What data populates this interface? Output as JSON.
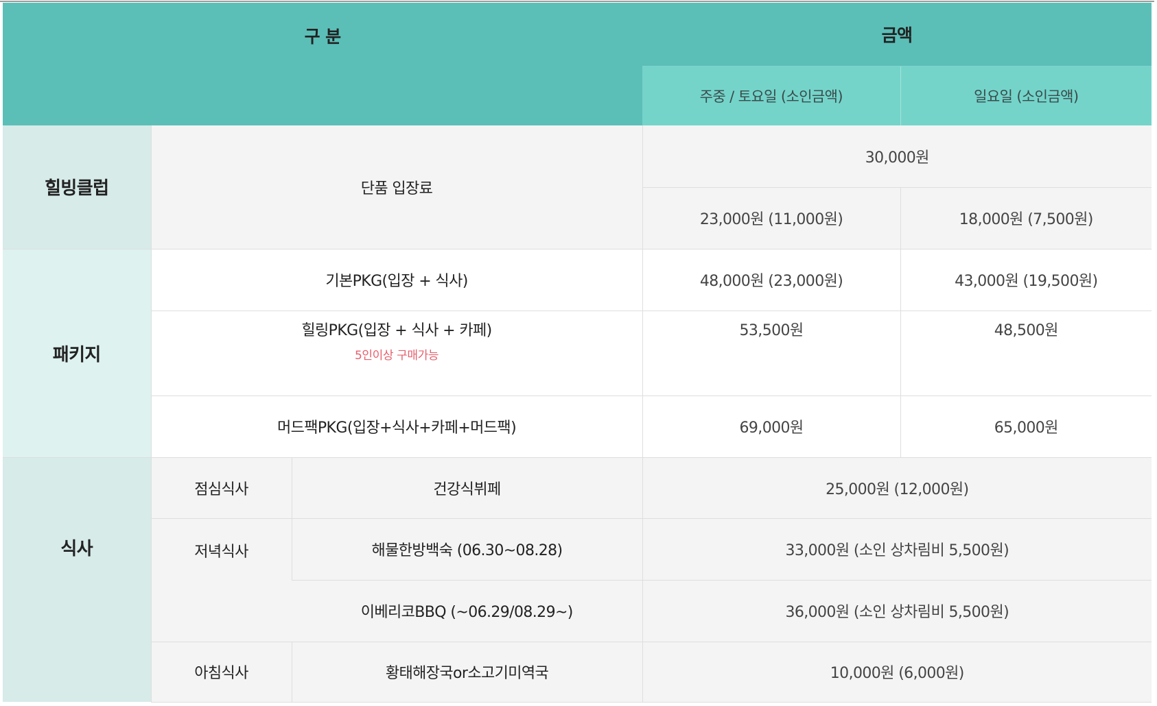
{
  "header": {
    "division": "구 분",
    "amount": "금액",
    "weekday_sat": "주중 / 토요일 (소인금액)",
    "sunday": "일요일 (소인금액)"
  },
  "healing_club": {
    "category": "힐빙클럽",
    "item": "단품 입장료",
    "price_all": "30,000원",
    "price_weekday_sat": "23,000원 (11,000원)",
    "price_sunday": "18,000원 (7,500원)"
  },
  "package": {
    "category": "패키지",
    "rows": [
      {
        "item": "기본PKG(입장 + 식사)",
        "note": "",
        "price_weekday_sat": "48,000원 (23,000원)",
        "price_sunday": "43,000원 (19,500원)"
      },
      {
        "item": "힐링PKG(입장 + 식사 + 카페)",
        "note": "5인이상 구매가능",
        "price_weekday_sat": "53,500원",
        "price_sunday": "48,500원"
      },
      {
        "item": "머드팩PKG(입장+식사+카페+머드팩)",
        "note": "",
        "price_weekday_sat": "69,000원",
        "price_sunday": "65,000원"
      }
    ]
  },
  "meal": {
    "category": "식사",
    "lunch": {
      "label": "점심식사",
      "item": "건강식뷔페",
      "price": "25,000원 (12,000원)"
    },
    "dinner": {
      "label": "저녁식사",
      "item": "해물한방백숙 (06.30~08.28)",
      "price": "33,000원 (소인 상차림비 5,500원)"
    },
    "dinner2": {
      "item": "이베리코BBQ (~06.29/08.29~)",
      "price": "36,000원 (소인 상차림비 5,500원)"
    },
    "breakfast": {
      "label": "아침식사",
      "item": "황태해장국or소고기미역국",
      "price": "10,000원 (6,000원)"
    }
  }
}
